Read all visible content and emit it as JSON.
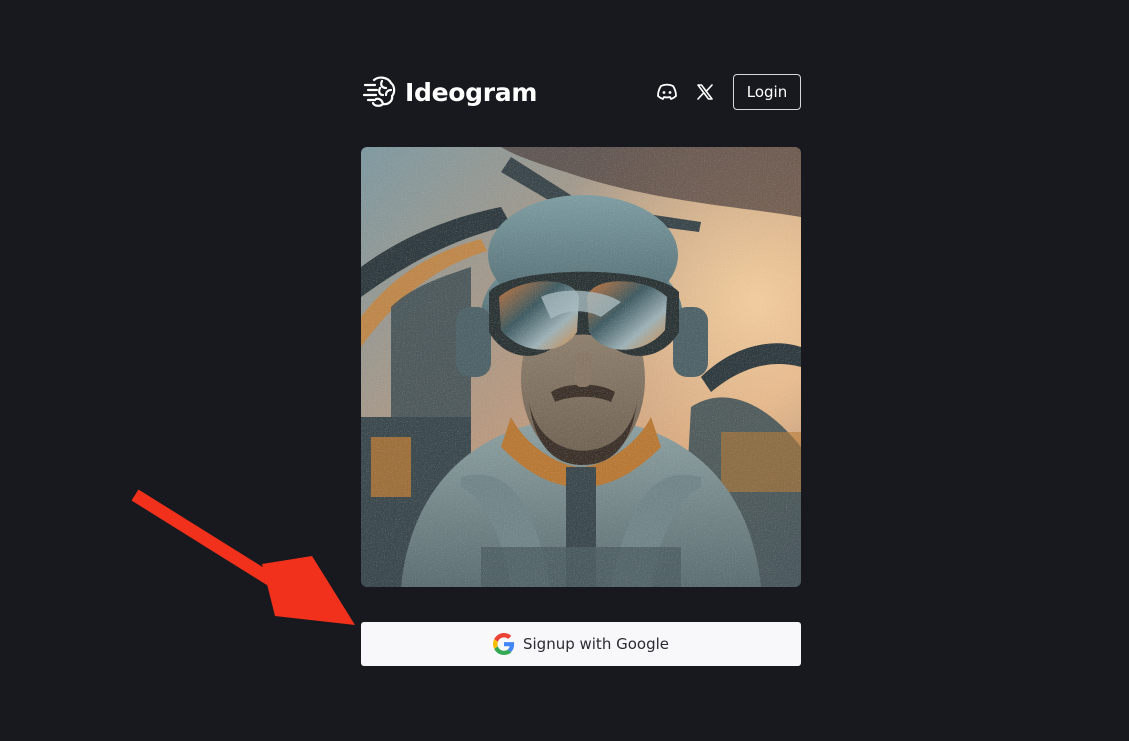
{
  "header": {
    "brand_name": "Ideogram",
    "brand_logo_icon": "brain-logo-icon",
    "discord_icon": "discord-icon",
    "x_icon": "x-twitter-icon",
    "login_label": "Login"
  },
  "hero": {
    "image_subject": "pilot-portrait-image"
  },
  "signup": {
    "label": "Signup with Google",
    "icon": "google-icon"
  },
  "annotation": {
    "icon": "red-arrow-icon",
    "color": "#f2311c"
  },
  "colors": {
    "background": "#18191e",
    "signup_button_bg": "#f8f8fa",
    "signup_text": "#2b2b30",
    "login_border": "#d7d8dc"
  }
}
